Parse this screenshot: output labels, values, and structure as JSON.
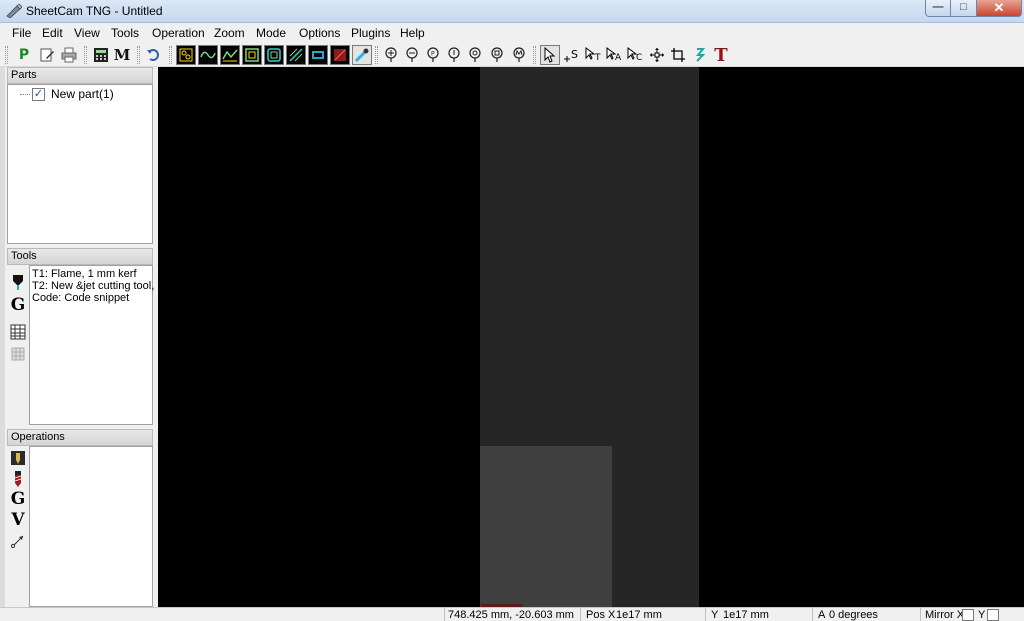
{
  "window": {
    "title": "SheetCam TNG - Untitled",
    "buttons": {
      "minimize": "—",
      "maximize": "□",
      "close": "✕"
    }
  },
  "menu": [
    "File",
    "Edit",
    "View",
    "Tools",
    "Operation",
    "Zoom",
    "Mode",
    "Options",
    "Plugins",
    "Help"
  ],
  "toolbar": {
    "program_label": "P",
    "machine_label": "M",
    "text_tool_label": "T",
    "s_tool_label": "S",
    "t_tool_label": "T",
    "a_tool_label": "A",
    "c_tool_label": "C"
  },
  "parts": {
    "header": "Parts",
    "items": [
      {
        "label": "New part(1)",
        "checked": "✓"
      }
    ]
  },
  "tools": {
    "header": "Tools",
    "items": [
      "T1: Flame, 1 mm kerf",
      "T2: New &jet cutting tool,",
      "Code: Code snippet"
    ],
    "icons": {
      "gcode": "G"
    }
  },
  "operations": {
    "header": "Operations",
    "icons": {
      "gcode": "G",
      "v": "V"
    }
  },
  "statusbar": {
    "cursor_pos": "748.425 mm, -20.603 mm",
    "pos_x_label": "Pos X",
    "pos_x_value": "1e17 mm",
    "y_label": "Y",
    "y_value": "1e17 mm",
    "a_label": "A",
    "a_value": "0 degrees",
    "mirror_x_label": "Mirror X",
    "mirror_y_label": "Y"
  },
  "colors": {
    "canvas": "#000000",
    "sheet": "#262626",
    "sheet_lower": "#404040"
  }
}
